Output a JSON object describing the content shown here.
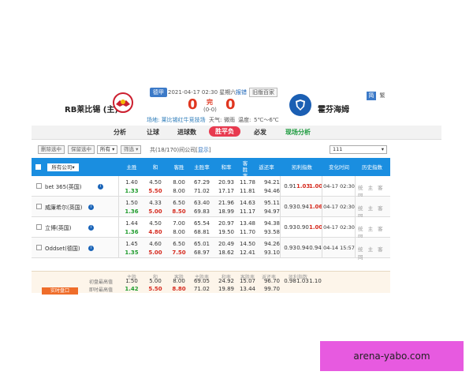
{
  "header": {
    "home_team": "RB莱比锡 (主)",
    "away_team": "霍芬海姆",
    "league": "德甲",
    "datetime": "2021-04-17 02:30 星期六",
    "links": [
      "报错",
      "旧版百家"
    ],
    "home_score": "0",
    "away_score": "0",
    "status": "完",
    "halftime": "(0-0)",
    "venue": "场地: 莱比锡红牛竞技场",
    "weather_label": "天气:",
    "weather_value": "微雨",
    "temp_label": "温度:",
    "temp_value": "5℃～6℃",
    "lang": [
      "简",
      "繁"
    ]
  },
  "nav": {
    "items": [
      "分析",
      "让球",
      "进球数",
      "胜平负",
      "必发",
      "现场分析"
    ],
    "active": "胜平负"
  },
  "toolbar": {
    "delete_selected": "删除选中",
    "keep_selected": "保留选中",
    "all": "所有",
    "filter": "筛选",
    "summary_prefix": "共(",
    "summary_count": "18/170",
    "summary_suffix": ")间公司",
    "show": "显示",
    "right_select": "111"
  },
  "table": {
    "company_header": "所有公司",
    "headers": [
      "主胜",
      "和",
      "客胜",
      "主胜率",
      "和率",
      "客胜率",
      "返还率",
      "凯利指数",
      "变化时间",
      "历史指数"
    ],
    "rows": [
      {
        "company": "bet 365(英国)",
        "open": [
          "1.40",
          "4.50",
          "8.00",
          "67.29",
          "20.93",
          "11.78",
          "94.21"
        ],
        "live": [
          "1.33",
          "5.50",
          "8.00",
          "71.02",
          "17.17",
          "11.81",
          "94.46"
        ],
        "kelly": [
          "0.91",
          "1.03",
          "1.00"
        ],
        "time": "04-17 02:30",
        "hist": "统 主 客 同"
      },
      {
        "company": "威廉希尔(英国)",
        "open": [
          "1.50",
          "4.33",
          "6.50",
          "63.40",
          "21.96",
          "14.63",
          "95.11"
        ],
        "live": [
          "1.36",
          "5.00",
          "8.50",
          "69.83",
          "18.99",
          "11.17",
          "94.97"
        ],
        "kelly": [
          "0.93",
          "0.94",
          "1.06"
        ],
        "time": "04-17 02:30",
        "hist": "统 主 客 同"
      },
      {
        "company": "立博(英国)",
        "open": [
          "1.44",
          "4.50",
          "7.00",
          "65.54",
          "20.97",
          "13.48",
          "94.38"
        ],
        "live": [
          "1.36",
          "4.80",
          "8.00",
          "68.81",
          "19.50",
          "11.70",
          "93.58"
        ],
        "kelly": [
          "0.93",
          "0.90",
          "1.00"
        ],
        "time": "04-17 02:30",
        "hist": "统 主 客 同"
      },
      {
        "company": "Oddset(德国)",
        "open": [
          "1.45",
          "4.60",
          "6.50",
          "65.01",
          "20.49",
          "14.50",
          "94.26"
        ],
        "live": [
          "1.35",
          "5.00",
          "7.50",
          "68.97",
          "18.62",
          "12.41",
          "93.10"
        ],
        "kelly": [
          "0.93",
          "0.94",
          "0.94"
        ],
        "time": "04-14 15:57",
        "hist": "统 主 客 同"
      }
    ],
    "summary_headers": [
      "主胜",
      "和",
      "客胜",
      "主胜率",
      "和率",
      "客胜率",
      "返还率",
      "凯利指数"
    ],
    "summary_rows": [
      {
        "label": "初盘最高值",
        "values": [
          "1.50",
          "5.00",
          "8.00",
          "69.05",
          "24.92",
          "15.07",
          "96.70"
        ],
        "kelly": [
          "0.98",
          "1.03",
          "1.10"
        ]
      },
      {
        "label": "即时最高值",
        "values": [
          "1.42",
          "5.50",
          "8.80",
          "71.02",
          "19.89",
          "13.44",
          "99.70"
        ],
        "kelly": []
      }
    ],
    "cta": "实时盘口"
  },
  "banner": {
    "text": "arena-yabo.com"
  },
  "colors": {
    "header_blue": "#1a8ee0",
    "active_red": "#e83a4f",
    "banner_pink": "#e75ae0"
  }
}
